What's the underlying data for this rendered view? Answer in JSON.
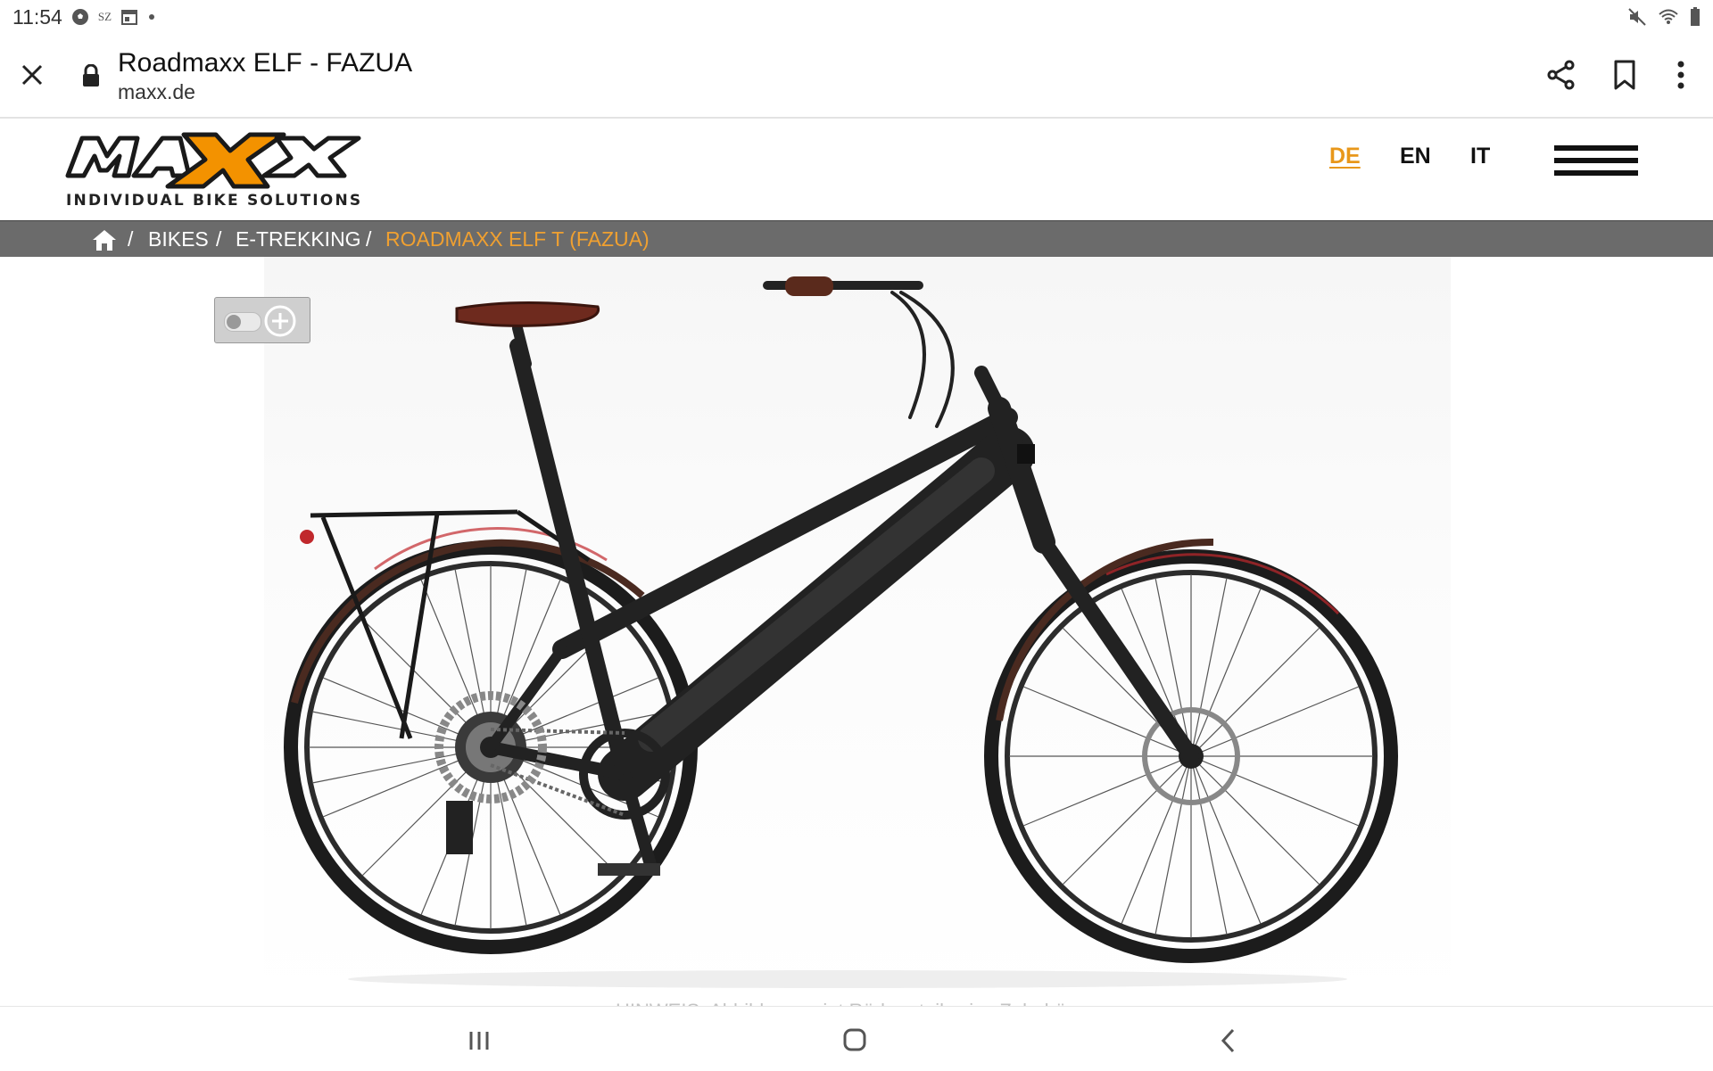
{
  "status_bar": {
    "time": "11:54",
    "notif_text": "SZ",
    "icons": [
      "soccer-icon",
      "sz-icon",
      "calendar-icon",
      "dot-icon",
      "mute-icon",
      "wifi-icon",
      "battery-icon"
    ]
  },
  "browser": {
    "title": "Roadmaxx ELF - FAZUA",
    "url": "maxx.de",
    "icons": [
      "close-icon",
      "lock-icon",
      "share-icon",
      "bookmark-icon",
      "more-icon"
    ]
  },
  "site": {
    "logo_text": "MAXX",
    "tagline": "INDIVIDUAL BIKE SOLUTIONS",
    "languages": [
      "DE",
      "EN",
      "IT"
    ],
    "active_language": "DE",
    "accent_color": "#e8971a",
    "logo_x_color": "#f39200"
  },
  "breadcrumb": {
    "items": [
      "BIKES",
      "E-TREKKING"
    ],
    "separator": "/",
    "current": "ROADMAXX ELF T (FAZUA)",
    "current_color": "#f0a030"
  },
  "product": {
    "image_alt": "Roadmaxx ELF T e-trekking bike, black frame with brown saddle",
    "notice_text": "HINWEIS: Abbildung zeigt Rädern teilweise Zubehör"
  },
  "navbar": {
    "icons": [
      "recent-apps-icon",
      "home-icon",
      "back-icon"
    ]
  }
}
